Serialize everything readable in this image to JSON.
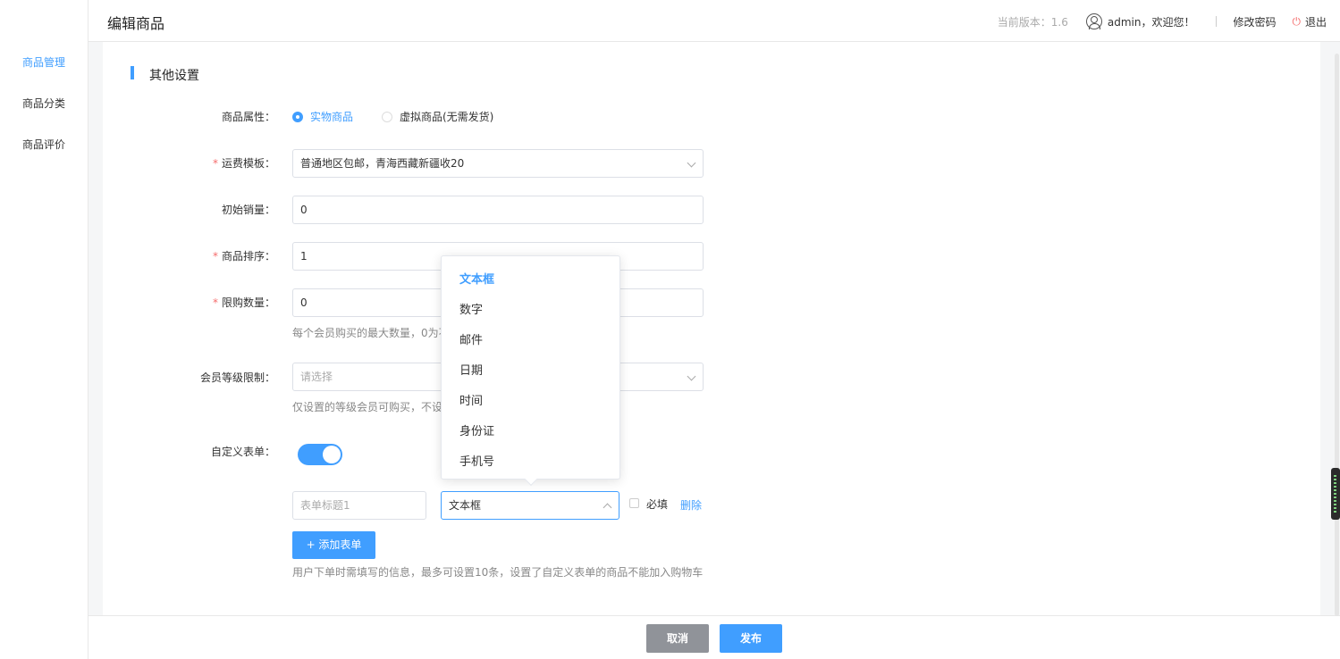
{
  "sidebar": {
    "items": [
      {
        "label": "商品管理",
        "active": true
      },
      {
        "label": "商品分类",
        "active": false
      },
      {
        "label": "商品评价",
        "active": false
      }
    ]
  },
  "header": {
    "title": "编辑商品",
    "version": "当前版本：1.6",
    "welcome": "admin，欢迎您！",
    "change_password": "修改密码",
    "logout": "退出"
  },
  "section": {
    "title": "其他设置"
  },
  "form": {
    "attr_label": "商品属性：",
    "attr_options": [
      {
        "label": "实物商品",
        "checked": true
      },
      {
        "label": "虚拟商品(无需发货)",
        "checked": false
      }
    ],
    "shipping_label": "运费模板：",
    "shipping_value": "普通地区包邮，青海西藏新疆收20",
    "initial_sales_label": "初始销量：",
    "initial_sales_value": "0",
    "sort_label": "商品排序：",
    "sort_value": "1",
    "limit_label": "限购数量：",
    "limit_value": "0",
    "limit_help": "每个会员购买的最大数量，0为不",
    "member_level_label": "会员等级限制：",
    "member_level_placeholder": "请选择",
    "member_level_help": "仅设置的等级会员可购买，不设",
    "custom_form_label": "自定义表单：",
    "custom_form_enabled": true,
    "form_title_placeholder": "表单标题1",
    "form_type_value": "文本框",
    "required_label": "必填",
    "delete_label": "删除",
    "add_form_label": "+ 添加表单",
    "add_form_help": "用户下单时需填写的信息，最多可设置10条，设置了自定义表单的商品不能加入购物车"
  },
  "dropdown": {
    "options": [
      {
        "label": "文本框",
        "selected": true
      },
      {
        "label": "数字",
        "selected": false
      },
      {
        "label": "邮件",
        "selected": false
      },
      {
        "label": "日期",
        "selected": false
      },
      {
        "label": "时间",
        "selected": false
      },
      {
        "label": "身份证",
        "selected": false
      },
      {
        "label": "手机号",
        "selected": false
      }
    ]
  },
  "footer": {
    "cancel_label": "取消",
    "publish_label": "发布"
  },
  "colors": {
    "accent": "#409eff",
    "danger": "#f56c6c",
    "cancel_button": "#909399"
  }
}
